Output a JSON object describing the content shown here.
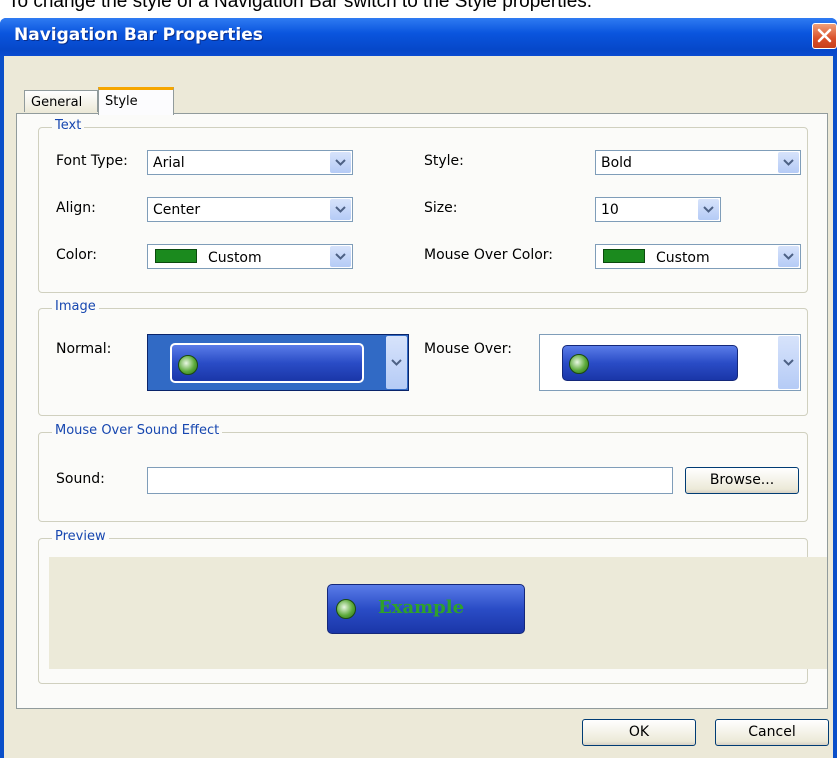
{
  "caption": "To change the style of a Navigation Bar switch to the Style properties.",
  "window": {
    "title": "Navigation Bar Properties"
  },
  "tabs": [
    {
      "label": "General"
    },
    {
      "label": "Style"
    }
  ],
  "text_group": {
    "title": "Text",
    "font_type": {
      "label": "Font Type:",
      "value": "Arial"
    },
    "style": {
      "label": "Style:",
      "value": "Bold"
    },
    "align": {
      "label": "Align:",
      "value": "Center"
    },
    "size": {
      "label": "Size:",
      "value": "10"
    },
    "color": {
      "label": "Color:",
      "value": "Custom",
      "swatch": "#1b8a1e"
    },
    "mouse_over_color": {
      "label": "Mouse Over Color:",
      "value": "Custom",
      "swatch": "#1b8a1e"
    }
  },
  "image_group": {
    "title": "Image",
    "normal": {
      "label": "Normal:"
    },
    "mouse_over": {
      "label": "Mouse Over:"
    }
  },
  "sound_group": {
    "title": "Mouse Over Sound Effect",
    "sound": {
      "label": "Sound:",
      "value": ""
    },
    "browse_label": "Browse..."
  },
  "preview_group": {
    "title": "Preview",
    "example_text": "Example",
    "example_text_color": "#2fa12a"
  },
  "buttons": {
    "ok": "OK",
    "cancel": "Cancel"
  },
  "colors": {
    "titlebar": "#0a55de",
    "dialog_face": "#ece9d8",
    "group_title": "#1747b0",
    "tab_highlight": "#f6a600"
  }
}
